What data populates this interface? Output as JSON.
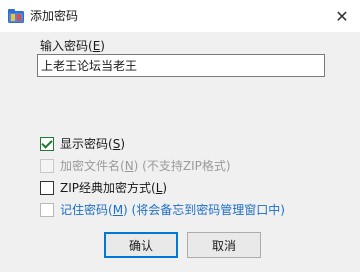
{
  "window": {
    "title": "添加密码"
  },
  "password": {
    "label": "输入密码(",
    "label_key": "E",
    "label_end": ")",
    "value": "上老王论坛当老王"
  },
  "options": [
    {
      "label": "显示密码(",
      "key": "S",
      "end": ")",
      "extra": "",
      "checked": true,
      "disabled": false
    },
    {
      "label": "加密文件名(",
      "key": "N",
      "end": ")",
      "extra": " (不支持ZIP格式)",
      "checked": false,
      "disabled": true
    },
    {
      "label": "ZIP经典加密方式(",
      "key": "L",
      "end": ")",
      "extra": "",
      "checked": false,
      "disabled": false
    },
    {
      "label": "记住密码(",
      "key": "M",
      "end": ")",
      "extra": " (将会备忘到密码管理窗口中)",
      "checked": false,
      "disabled": false
    }
  ],
  "buttons": {
    "ok": "确认",
    "cancel": "取消"
  },
  "icons": {
    "app": "folder-key-icon",
    "close": "close-icon"
  },
  "colors": {
    "accent": "#0078d7",
    "check": "#1f7a2f",
    "link": "#1d6ec5",
    "disabled_text": "#9b9b9b"
  }
}
